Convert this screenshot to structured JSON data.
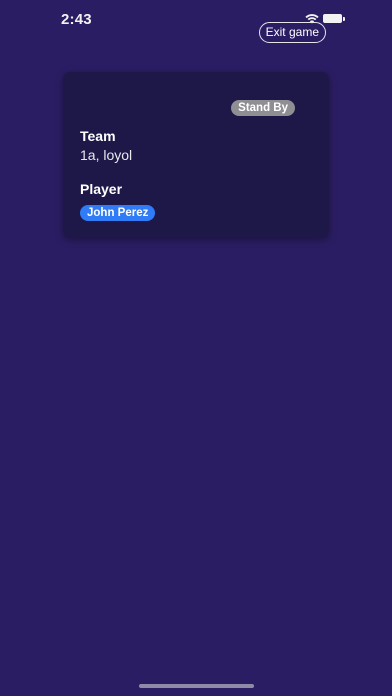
{
  "status_bar": {
    "time": "2:43",
    "icons": [
      "wifi-icon",
      "battery-icon"
    ]
  },
  "header": {
    "exit_label": "Exit game"
  },
  "card": {
    "status_badge": "Stand By",
    "team_heading": "Team",
    "team_value": "1a, loyol",
    "player_heading": "Player",
    "player_name": "John Perez"
  },
  "colors": {
    "background": "#2b1d63",
    "card": "#1e1848",
    "badge_gray": "#8e8e93",
    "player_chip_blue": "#2f7cf6"
  }
}
